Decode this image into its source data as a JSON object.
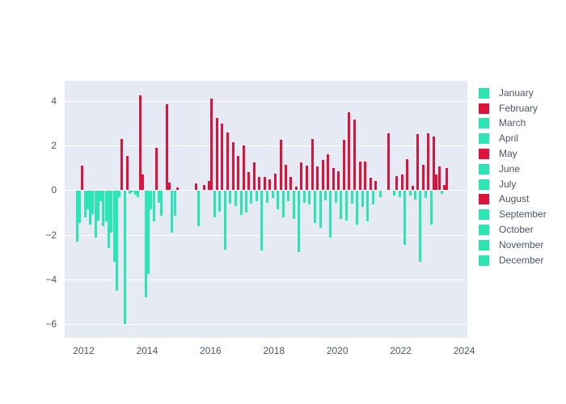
{
  "chart_data": {
    "type": "bar",
    "title": "",
    "subtitle": "",
    "xlabel": "",
    "ylabel": "",
    "xlim": [
      2011.4,
      2024.1
    ],
    "ylim": [
      -6.6,
      4.9
    ],
    "grid": true,
    "x_ticks": [
      2012,
      2014,
      2016,
      2018,
      2020,
      2022,
      2024
    ],
    "y_ticks": [
      4,
      2,
      0,
      -2,
      -4,
      -6
    ],
    "legend_position": "right",
    "legend": [
      {
        "name": "January",
        "color": "#2BE5B4"
      },
      {
        "name": "February",
        "color": "#DB143C"
      },
      {
        "name": "March",
        "color": "#2BE5B4"
      },
      {
        "name": "April",
        "color": "#2BE5B4"
      },
      {
        "name": "May",
        "color": "#DB143C"
      },
      {
        "name": "June",
        "color": "#2BE5B4"
      },
      {
        "name": "July",
        "color": "#2BE5B4"
      },
      {
        "name": "August",
        "color": "#DB143C"
      },
      {
        "name": "September",
        "color": "#2BE5B4"
      },
      {
        "name": "October",
        "color": "#2BE5B4"
      },
      {
        "name": "November",
        "color": "#2BE5B4"
      },
      {
        "name": "December",
        "color": "#2BE5B4"
      }
    ],
    "colors": {
      "positive": "#DB143C",
      "negative": "#2BE5B4",
      "plot_background": "#E5EAF4",
      "page_background": "#FFFFFF",
      "gridline": "#FFFFFF",
      "tick_text": "#4A5568"
    },
    "x": [
      2011.79,
      2011.88,
      2011.96,
      2012.04,
      2012.12,
      2012.21,
      2012.29,
      2012.37,
      2012.46,
      2012.54,
      2012.62,
      2012.71,
      2012.79,
      2012.87,
      2012.96,
      2013.04,
      2013.12,
      2013.21,
      2013.29,
      2013.37,
      2013.46,
      2013.54,
      2013.62,
      2013.71,
      2013.79,
      2013.87,
      2013.96,
      2014.04,
      2014.12,
      2014.21,
      2014.29,
      2014.37,
      2014.46,
      2014.62,
      2014.71,
      2014.79,
      2014.87,
      2014.96,
      2015.54,
      2015.62,
      2015.79,
      2015.96,
      2016.04,
      2016.12,
      2016.21,
      2016.29,
      2016.37,
      2016.46,
      2016.54,
      2016.62,
      2016.71,
      2016.79,
      2016.87,
      2016.96,
      2017.04,
      2017.12,
      2017.21,
      2017.29,
      2017.37,
      2017.46,
      2017.54,
      2017.62,
      2017.71,
      2017.79,
      2017.87,
      2017.96,
      2018.04,
      2018.12,
      2018.21,
      2018.29,
      2018.37,
      2018.46,
      2018.54,
      2018.62,
      2018.71,
      2018.79,
      2018.87,
      2018.96,
      2019.04,
      2019.12,
      2019.21,
      2019.29,
      2019.37,
      2019.46,
      2019.54,
      2019.62,
      2019.71,
      2019.79,
      2019.87,
      2019.96,
      2020.04,
      2020.12,
      2020.21,
      2020.29,
      2020.37,
      2020.46,
      2020.54,
      2020.62,
      2020.71,
      2020.79,
      2020.87,
      2020.96,
      2021.04,
      2021.12,
      2021.21,
      2021.37,
      2021.62,
      2021.79,
      2021.87,
      2021.96,
      2022.04,
      2022.12,
      2022.21,
      2022.29,
      2022.37,
      2022.46,
      2022.54,
      2022.62,
      2022.71,
      2022.79,
      2022.87,
      2022.96,
      2023.04,
      2023.12,
      2023.21,
      2023.29,
      2023.37,
      2023.46
    ],
    "values": [
      -2.3,
      -1.45,
      1.1,
      -1.2,
      -0.85,
      -1.55,
      -1.05,
      -2.1,
      -1.35,
      -0.5,
      -1.6,
      -1.4,
      -2.6,
      -1.9,
      -3.2,
      -4.5,
      -0.3,
      2.3,
      -6.0,
      1.55,
      -0.15,
      -0.1,
      -0.2,
      -0.3,
      4.25,
      0.7,
      -4.8,
      -3.75,
      -0.85,
      -1.4,
      1.9,
      -0.55,
      -1.15,
      3.85,
      0.35,
      -1.9,
      -1.15,
      0.12,
      0.3,
      -1.6,
      0.25,
      0.4,
      4.1,
      -1.2,
      3.25,
      -0.95,
      3.0,
      -2.65,
      2.6,
      -0.6,
      2.15,
      -0.7,
      1.55,
      -1.1,
      2.0,
      -1.0,
      0.8,
      -0.6,
      1.25,
      -0.5,
      0.6,
      -2.7,
      0.6,
      -0.55,
      0.5,
      -0.35,
      0.75,
      -0.85,
      2.25,
      -1.2,
      1.15,
      -0.5,
      0.6,
      -1.3,
      0.15,
      -2.75,
      1.25,
      -0.55,
      1.1,
      -0.65,
      2.3,
      -1.45,
      1.05,
      -1.7,
      1.35,
      -0.45,
      1.6,
      -2.1,
      1.0,
      -0.55,
      0.85,
      -1.3,
      2.25,
      -1.35,
      3.5,
      -0.6,
      3.15,
      -1.55,
      1.3,
      -0.75,
      1.3,
      -1.4,
      0.55,
      -0.65,
      0.4,
      -0.3,
      2.55,
      -0.25,
      0.65,
      -0.3,
      0.7,
      -2.45,
      1.4,
      -0.25,
      0.2,
      -0.4,
      2.5,
      -3.2,
      1.15,
      -0.35,
      2.55,
      -1.55,
      2.4,
      0.7,
      1.05,
      -0.15,
      0.25,
      1.0
    ]
  }
}
